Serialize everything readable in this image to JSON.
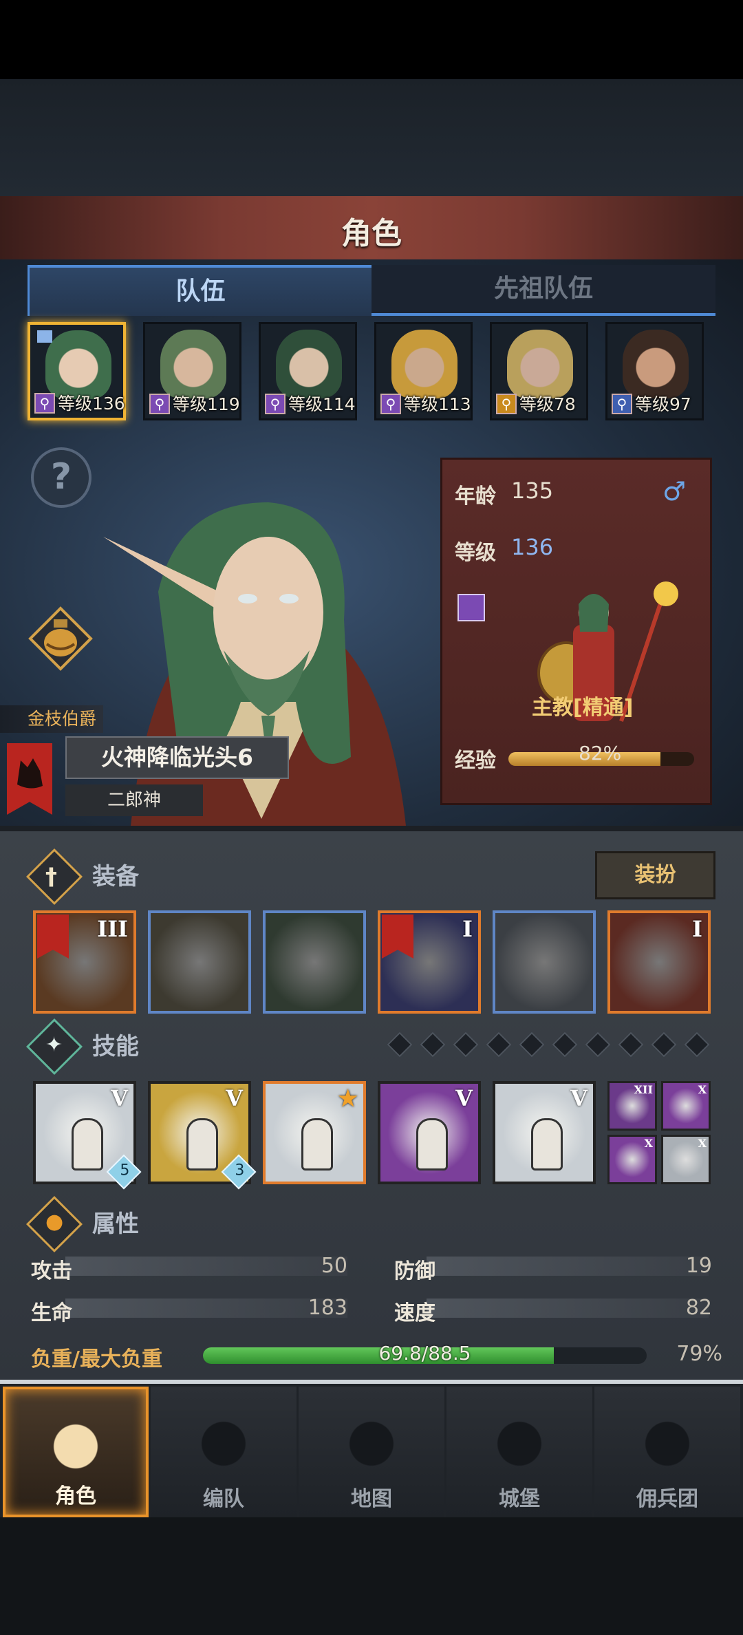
{
  "header": {
    "title": "角色"
  },
  "tabs": {
    "active": "队伍",
    "inactive": "先祖队伍"
  },
  "party": [
    {
      "level": "等级136",
      "selected": true,
      "hair": "#3f6e4c",
      "skin": "#e6cbb3",
      "cls_color": "#7b4ab3"
    },
    {
      "level": "等级119",
      "selected": false,
      "hair": "#5d7a55",
      "skin": "#d7b79d",
      "cls_color": "#7b4ab3"
    },
    {
      "level": "等级114",
      "selected": false,
      "hair": "#2f4f3a",
      "skin": "#d9c0a8",
      "cls_color": "#7b4ab3"
    },
    {
      "level": "等级113",
      "selected": false,
      "hair": "#c79a3b",
      "skin": "#caa88c",
      "cls_color": "#7b4ab3"
    },
    {
      "level": "等级78",
      "selected": false,
      "hair": "#b9a05c",
      "skin": "#c9a997",
      "cls_color": "#c98a1e"
    },
    {
      "level": "等级97",
      "selected": false,
      "hair": "#3b2a22",
      "skin": "#c99b7d",
      "cls_color": "#3f5fb0"
    }
  ],
  "character": {
    "title_rank": "金枝伯爵",
    "name": "火神降临光头6",
    "nickname": "二郎神",
    "age_label": "年龄",
    "age": "135",
    "level_label": "等级",
    "level": "136",
    "gender_icon": "♂",
    "class_name": "主教[精通]",
    "exp_label": "经验",
    "exp_text": "82%",
    "exp_fraction": 0.82
  },
  "equipment": {
    "header": "装备",
    "dress_button": "装扮",
    "items": [
      {
        "name": "staff-icon",
        "tier": "III",
        "border": "#e07b2c",
        "bg": "#5a3a22",
        "banner": true
      },
      {
        "name": "round-shield-icon",
        "tier": "",
        "border": "#5f86c6",
        "bg": "#3d3a30",
        "banner": false
      },
      {
        "name": "hood-icon",
        "tier": "",
        "border": "#5f86c6",
        "bg": "#2f3a30",
        "banner": false
      },
      {
        "name": "armor-icon",
        "tier": "I",
        "border": "#e07b2c",
        "bg": "#2d2f55",
        "banner": true
      },
      {
        "name": "boots-icon",
        "tier": "",
        "border": "#5f86c6",
        "bg": "#3b3f44",
        "banner": false
      },
      {
        "name": "trinket-icon",
        "tier": "I",
        "border": "#e07b2c",
        "bg": "#5b2a22",
        "banner": false
      }
    ]
  },
  "skills": {
    "header": "技能",
    "pips": 10,
    "items": [
      {
        "name": "lance-skill-icon",
        "tier": "V",
        "badge": "5",
        "bg": "#c8ced3",
        "border": "#222"
      },
      {
        "name": "holy-shield-skill-icon",
        "tier": "V",
        "badge": "3",
        "bg": "#c9a53f",
        "border": "#222"
      },
      {
        "name": "crystal-heal-skill-icon",
        "tier": "★",
        "badge": "",
        "bg": "#c8ced3",
        "border": "#e07b2c"
      },
      {
        "name": "crystal-hand-skill-icon",
        "tier": "V",
        "badge": "",
        "bg": "#7b3f9a",
        "border": "#222"
      },
      {
        "name": "crystal-hand-skill-icon",
        "tier": "V",
        "badge": "",
        "bg": "#c8ced3",
        "border": "#222"
      }
    ],
    "minis": [
      {
        "name": "spear-mini-icon",
        "tier": "XII",
        "bg": "#6b3a8a"
      },
      {
        "name": "burst-mini-icon",
        "tier": "X",
        "bg": "#7b3f9a"
      },
      {
        "name": "cross-mini-icon",
        "tier": "X",
        "bg": "#7b3f9a"
      },
      {
        "name": "burst-mini-icon",
        "tier": "X",
        "bg": "#aab0b6"
      }
    ]
  },
  "attributes": {
    "header": "属性",
    "attack_label": "攻击",
    "attack": "50",
    "defense_label": "防御",
    "defense": "19",
    "hp_label": "生命",
    "hp": "183",
    "speed_label": "速度",
    "speed": "82",
    "load_label": "负重/最大负重",
    "load_text": "69.8/88.5",
    "load_percent": "79%",
    "load_fraction": 0.79
  },
  "nav": [
    {
      "label": "角色",
      "active": true,
      "icon": "knight-icon"
    },
    {
      "label": "编队",
      "active": false,
      "icon": "helmet-icon"
    },
    {
      "label": "地图",
      "active": false,
      "icon": "compass-map-icon"
    },
    {
      "label": "城堡",
      "active": false,
      "icon": "castle-icon"
    },
    {
      "label": "佣兵团",
      "active": false,
      "icon": "mercenary-icon"
    }
  ]
}
